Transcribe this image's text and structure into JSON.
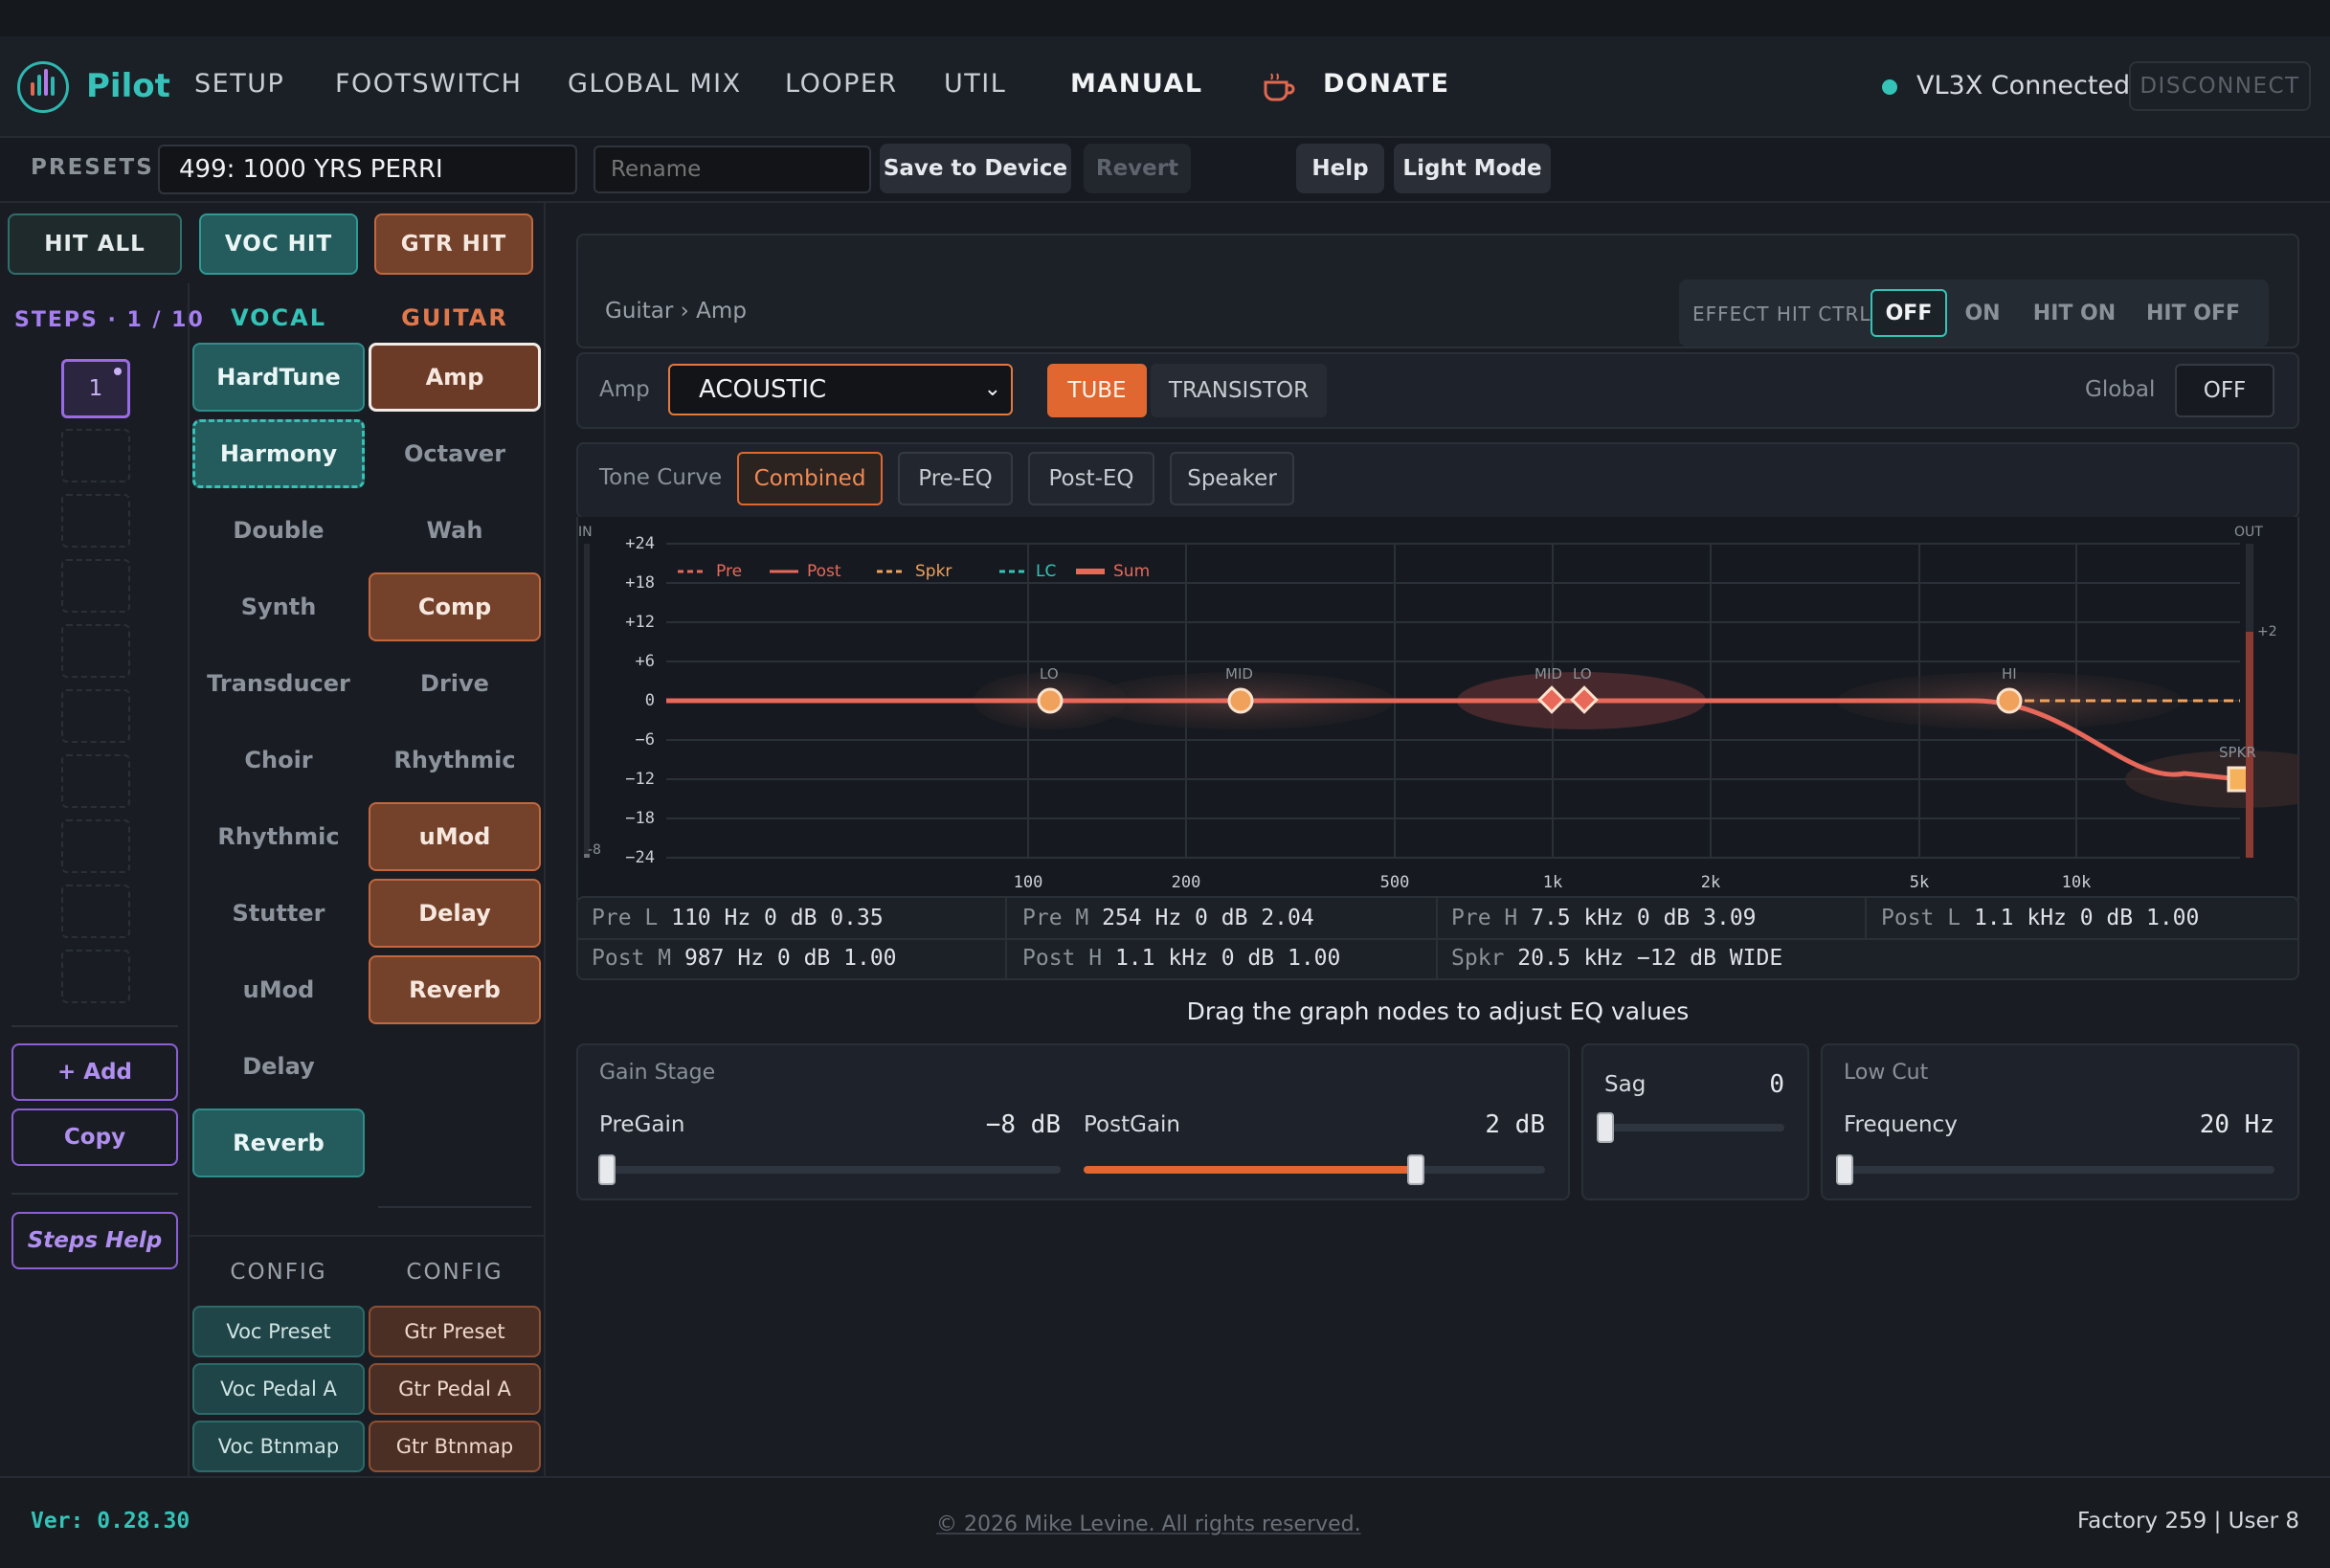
{
  "app": {
    "name": "Pilot"
  },
  "nav": {
    "items": [
      "SETUP",
      "FOOTSWITCH",
      "GLOBAL MIX",
      "LOOPER",
      "UTIL",
      "MANUAL"
    ],
    "donate": "DONATE",
    "status": "VL3X Connected",
    "disconnect": "DISCONNECT"
  },
  "presets": {
    "label": "PRESETS",
    "current": "499: 1000 YRS PERRI",
    "rename_placeholder": "Rename",
    "save": "Save to Device",
    "revert": "Revert",
    "help": "Help",
    "light_mode": "Light Mode"
  },
  "hits": {
    "hit_all": "HIT ALL",
    "voc_hit": "VOC HIT",
    "gtr_hit": "GTR HIT"
  },
  "steps": {
    "label": "STEPS · 1 / 10",
    "current": "1",
    "add": "+ Add",
    "copy": "Copy",
    "help": "Steps Help"
  },
  "vocal": {
    "header": "VOCAL",
    "effects": [
      {
        "label": "HardTune",
        "state": "on"
      },
      {
        "label": "Harmony",
        "state": "selected"
      },
      {
        "label": "Double",
        "state": "off"
      },
      {
        "label": "Synth",
        "state": "off"
      },
      {
        "label": "Transducer",
        "state": "off"
      },
      {
        "label": "Choir",
        "state": "off"
      },
      {
        "label": "Rhythmic",
        "state": "off"
      },
      {
        "label": "Stutter",
        "state": "off"
      },
      {
        "label": "uMod",
        "state": "off"
      },
      {
        "label": "Delay",
        "state": "off"
      },
      {
        "label": "Reverb",
        "state": "on"
      }
    ],
    "config_label": "CONFIG",
    "config": [
      "Voc Preset",
      "Voc Pedal A",
      "Voc Btnmap"
    ]
  },
  "guitar": {
    "header": "GUITAR",
    "effects": [
      {
        "label": "Amp",
        "state": "selected"
      },
      {
        "label": "Octaver",
        "state": "off"
      },
      {
        "label": "Wah",
        "state": "off"
      },
      {
        "label": "Comp",
        "state": "on"
      },
      {
        "label": "Drive",
        "state": "off"
      },
      {
        "label": "Rhythmic",
        "state": "off"
      },
      {
        "label": "uMod",
        "state": "on"
      },
      {
        "label": "Delay",
        "state": "on"
      },
      {
        "label": "Reverb",
        "state": "on"
      }
    ],
    "config_label": "CONFIG",
    "config": [
      "Gtr Preset",
      "Gtr Pedal A",
      "Gtr Btnmap"
    ]
  },
  "main": {
    "breadcrumb": "Guitar › Amp",
    "effect_hit": {
      "label": "EFFECT HIT CTRL:",
      "options": [
        "OFF",
        "ON",
        "HIT ON",
        "HIT OFF"
      ],
      "selected": "OFF"
    },
    "amp": {
      "label": "Amp",
      "type": "ACOUSTIC",
      "modes": [
        "TUBE",
        "TRANSISTOR"
      ],
      "selected_mode": "TUBE",
      "global_label": "Global",
      "global_value": "OFF"
    },
    "tone_curve": {
      "label": "Tone Curve",
      "tabs": [
        "Combined",
        "Pre-EQ",
        "Post-EQ",
        "Speaker"
      ],
      "selected": "Combined"
    },
    "graph": {
      "in_label": "IN",
      "out_label": "OUT",
      "in_meter": "-8",
      "out_meter": "+2",
      "y_ticks": [
        "+24",
        "+18",
        "+12",
        "+6",
        "0",
        "−6",
        "−12",
        "−18",
        "−24"
      ],
      "x_ticks": [
        "100",
        "200",
        "500",
        "1k",
        "2k",
        "5k",
        "10k"
      ],
      "legend": [
        "Pre",
        "Post",
        "Spkr",
        "LC",
        "Sum"
      ],
      "node_labels": [
        "LO",
        "MID",
        "MID",
        "LO",
        "HI",
        "SPKR"
      ],
      "colors": {
        "curve": "#e8685a",
        "node": "#f0a15c",
        "grid": "#2a3038"
      }
    },
    "params": [
      {
        "name": "Pre L",
        "value": "110 Hz 0 dB 0.35"
      },
      {
        "name": "Pre M",
        "value": "254 Hz 0 dB 2.04"
      },
      {
        "name": "Pre H",
        "value": "7.5 kHz 0 dB 3.09"
      },
      {
        "name": "Post L",
        "value": "1.1 kHz 0 dB 1.00"
      },
      {
        "name": "Post M",
        "value": "987 Hz 0 dB 1.00"
      },
      {
        "name": "Post H",
        "value": "1.1 kHz 0 dB 1.00"
      },
      {
        "name": "Spkr",
        "value": "20.5 kHz −12 dB WIDE"
      }
    ],
    "hint": "Drag the graph nodes to adjust EQ values",
    "gain_stage": {
      "title": "Gain Stage",
      "pregain_label": "PreGain",
      "pregain_value": "−8 dB",
      "postgain_label": "PostGain",
      "postgain_value": "2 dB"
    },
    "sag": {
      "label": "Sag",
      "value": "0"
    },
    "low_cut": {
      "title": "Low Cut",
      "label": "Frequency",
      "value": "20 Hz"
    }
  },
  "footer": {
    "version": "Ver: 0.28.30",
    "copyright": "© 2026 Mike Levine. All rights reserved.",
    "counts": "Factory 259 | User 8"
  }
}
